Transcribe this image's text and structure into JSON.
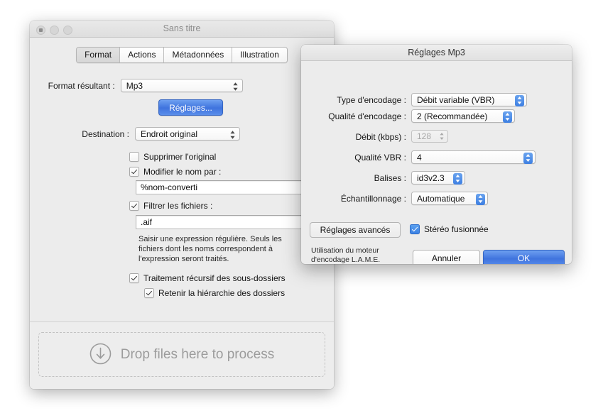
{
  "main_window": {
    "title": "Sans titre",
    "traffic_lights": [
      "close-button",
      "minimize-button",
      "zoom-button"
    ],
    "tabs": [
      {
        "label": "Format",
        "selected": true
      },
      {
        "label": "Actions",
        "selected": false
      },
      {
        "label": "Métadonnées",
        "selected": false
      },
      {
        "label": "Illustration",
        "selected": false
      }
    ],
    "format_label": "Format résultant :",
    "format_value": "Mp3",
    "settings_button": "Réglages...",
    "destination_label": "Destination :",
    "destination_value": "Endroit original",
    "checkboxes": {
      "delete_original": {
        "label": "Supprimer l'original",
        "checked": false
      },
      "rename": {
        "label": "Modifier le nom par :",
        "checked": true
      },
      "filter": {
        "label": "Filtrer les fichiers :",
        "checked": true
      },
      "recursive": {
        "label": "Traitement récursif des sous-dossiers",
        "checked": true
      },
      "keep_hierarchy": {
        "label": "Retenir la hiérarchie des dossiers",
        "checked": true
      }
    },
    "rename_value": "%nom-converti",
    "filter_value": ".aif",
    "filter_help": "Saisir une expression régulière. Seuls les fichiers dont les noms correspondent à l'expression seront traités.",
    "dropzone_text": "Drop files here to process"
  },
  "mp3_dialog": {
    "title": "Réglages Mp3",
    "fields": [
      {
        "label": "Type d'encodage :",
        "value": "Débit variable (VBR)",
        "kind": "popup",
        "enabled": true
      },
      {
        "label": "Qualité d'encodage :",
        "value": "2 (Recommandée)",
        "kind": "popup",
        "enabled": true
      },
      {
        "label": "Débit (kbps) :",
        "value": "128",
        "kind": "stepper",
        "enabled": false
      },
      {
        "label": "Qualité VBR :",
        "value": "4",
        "kind": "popup",
        "enabled": true
      },
      {
        "label": "Balises :",
        "value": "id3v2.3",
        "kind": "popup",
        "enabled": true
      },
      {
        "label": "Échantillonnage :",
        "value": "Automatique",
        "kind": "popup",
        "enabled": true
      }
    ],
    "advanced_button": "Réglages avancés",
    "joint_stereo": {
      "label": "Stéréo fusionnée",
      "checked": true
    },
    "engine_note": "Utilisation du moteur d'encodage L.A.M.E.",
    "cancel_button": "Annuler",
    "ok_button": "OK"
  },
  "colors": {
    "accent_blue": "#4478e0",
    "window_bg": "#ececec",
    "title_text": "#8b8b8b"
  }
}
